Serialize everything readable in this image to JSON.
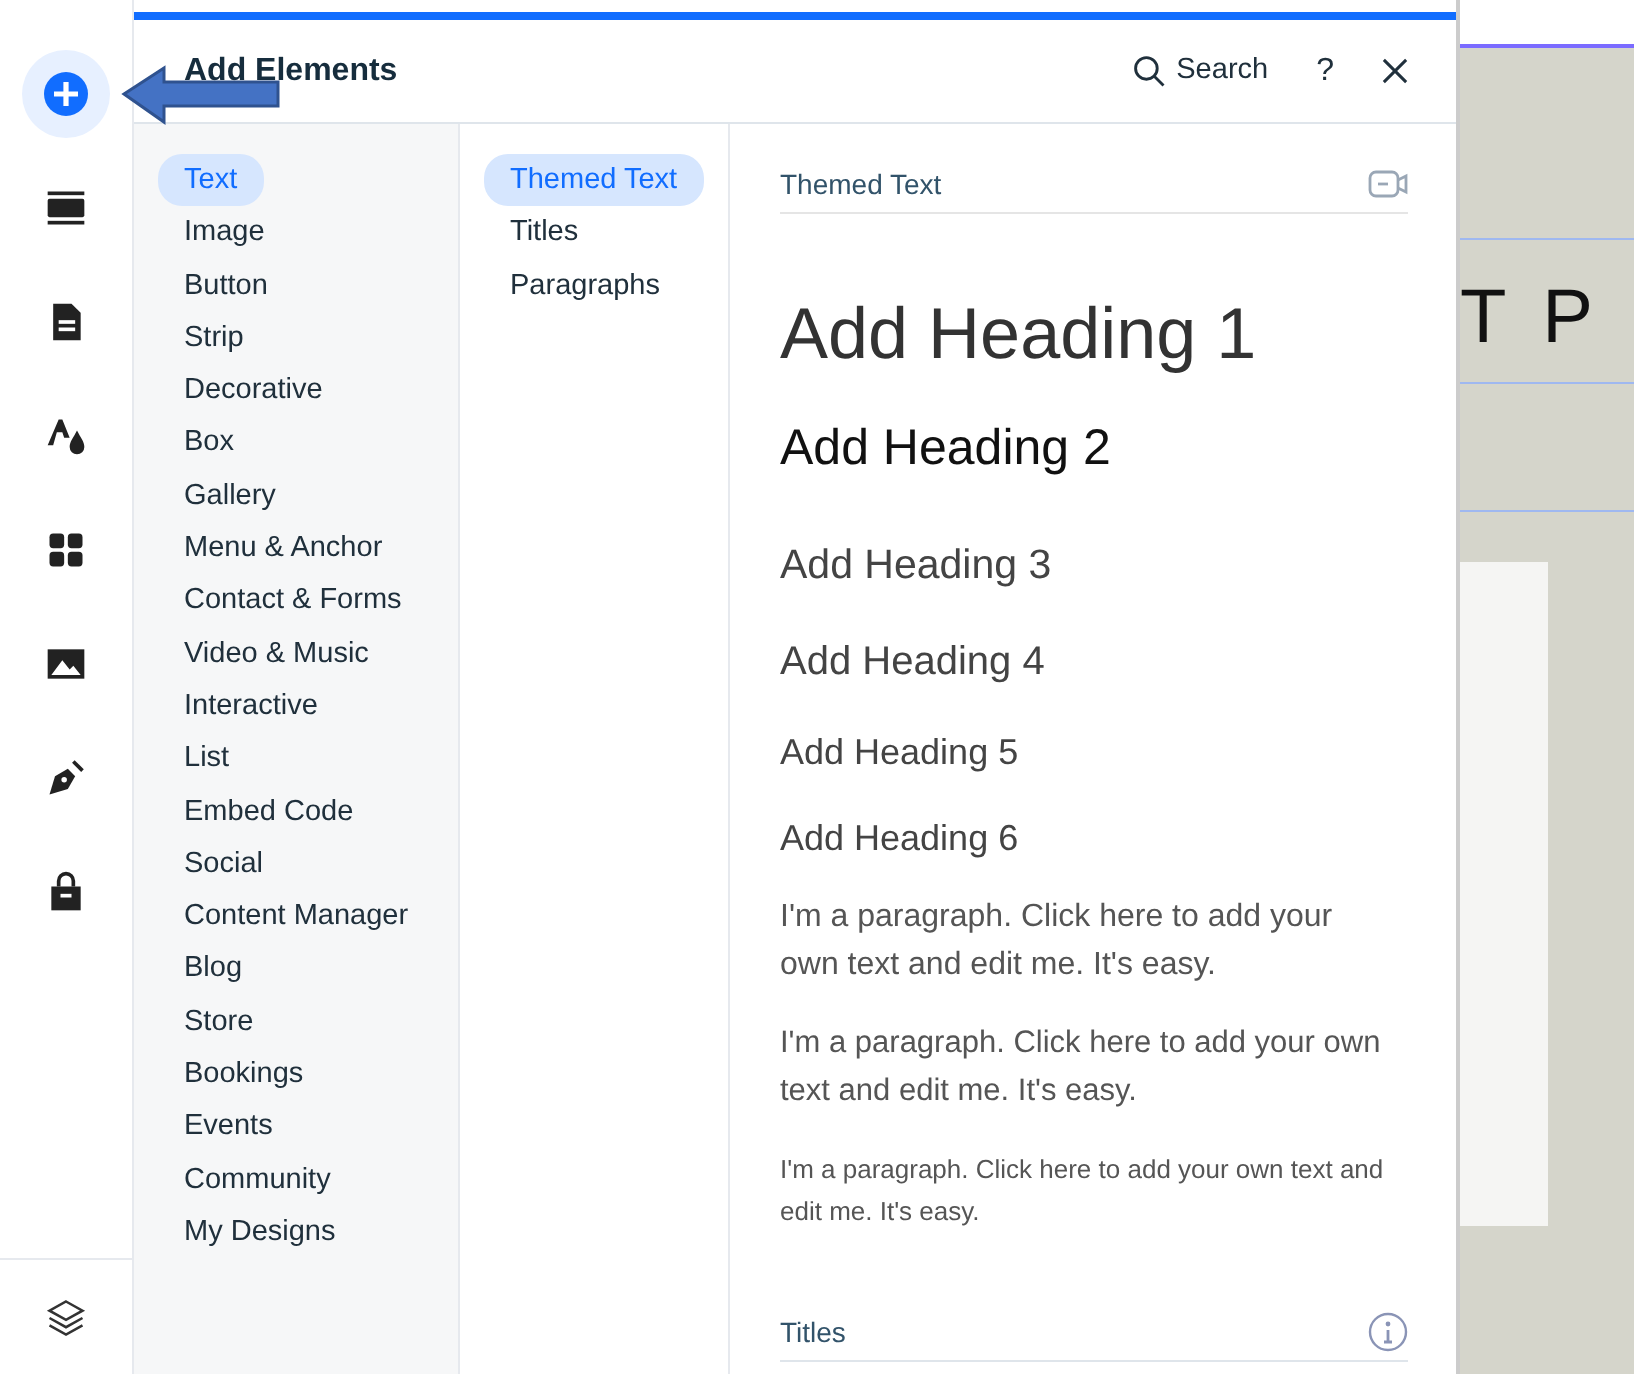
{
  "rail": {
    "items": [
      {
        "kind": "add",
        "selected": true
      },
      {
        "kind": "sections",
        "selected": false
      },
      {
        "kind": "pages",
        "selected": false
      },
      {
        "kind": "design",
        "selected": false
      },
      {
        "kind": "apps",
        "selected": false
      },
      {
        "kind": "media",
        "selected": false
      },
      {
        "kind": "pen",
        "selected": false
      },
      {
        "kind": "bag",
        "selected": false
      }
    ],
    "bottom": {
      "kind": "layers"
    }
  },
  "panel": {
    "title": "Add Elements",
    "search": "Search",
    "help": "?",
    "categories": [
      {
        "label": "Text",
        "selected": true
      },
      {
        "label": "Image",
        "selected": false
      },
      {
        "label": "Button",
        "selected": false
      },
      {
        "label": "Strip",
        "selected": false
      },
      {
        "label": "Decorative",
        "selected": false
      },
      {
        "label": "Box",
        "selected": false
      },
      {
        "label": "Gallery",
        "selected": false
      },
      {
        "label": "Menu & Anchor",
        "selected": false
      },
      {
        "label": "Contact & Forms",
        "selected": false
      },
      {
        "label": "Video & Music",
        "selected": false
      },
      {
        "label": "Interactive",
        "selected": false
      },
      {
        "label": "List",
        "selected": false
      },
      {
        "label": "Embed Code",
        "selected": false
      },
      {
        "label": "Social",
        "selected": false
      },
      {
        "label": "Content Manager",
        "selected": false
      },
      {
        "label": "Blog",
        "selected": false
      },
      {
        "label": "Store",
        "selected": false
      },
      {
        "label": "Bookings",
        "selected": false
      },
      {
        "label": "Events",
        "selected": false
      },
      {
        "label": "Community",
        "selected": false
      },
      {
        "label": "My Designs",
        "selected": false
      }
    ],
    "subcategories": [
      {
        "label": "Themed Text",
        "selected": true
      },
      {
        "label": "Titles",
        "selected": false
      },
      {
        "label": "Paragraphs",
        "selected": false
      }
    ],
    "sections": [
      {
        "title": "Themed Text",
        "kind": "video",
        "samples": [
          {
            "kind": "h1",
            "text": "Add Heading 1"
          },
          {
            "kind": "h2",
            "text": "Add Heading 2"
          },
          {
            "kind": "h3",
            "text": "Add Heading 3"
          },
          {
            "kind": "h4",
            "text": "Add Heading 4"
          },
          {
            "kind": "h5",
            "text": "Add Heading 5"
          },
          {
            "kind": "h6",
            "text": "Add Heading 6"
          },
          {
            "kind": "p1",
            "text": "I'm a paragraph. Click here to add your own text and edit me. It's easy."
          },
          {
            "kind": "p2",
            "text": "I'm a paragraph. Click here to add your own text and edit me. It's easy."
          },
          {
            "kind": "p3",
            "text": "I'm a paragraph. Click here to add your own text and edit me. It's easy."
          }
        ]
      },
      {
        "title": "Titles",
        "kind": "info"
      }
    ]
  },
  "canvas": {
    "heading": "T P"
  }
}
